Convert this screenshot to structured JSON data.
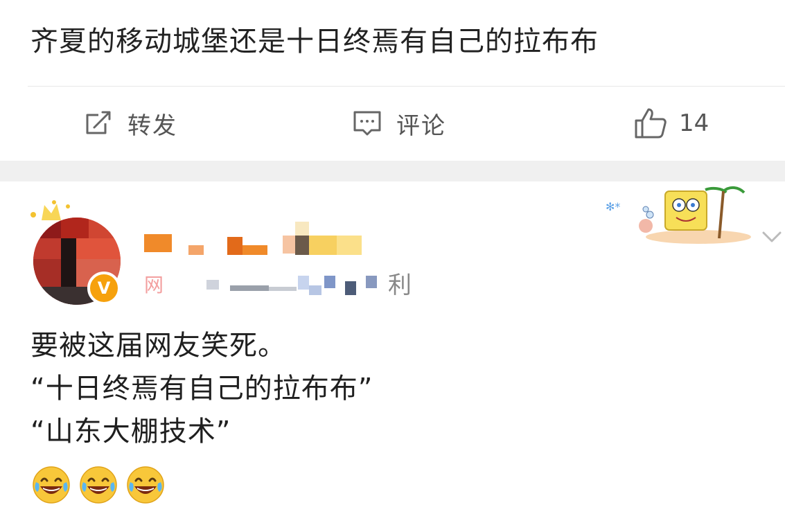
{
  "post": {
    "text": "齐夏的移动城堡还是十日终焉有自己的拉布布"
  },
  "actions": {
    "repost_label": "转发",
    "comment_label": "评论",
    "like_count": "14"
  },
  "reply": {
    "meta_tail": "利",
    "meta_head": "网",
    "lines": [
      "要被这届网友笑死。",
      "“十日终焉有自己的拉布布”",
      "“山东大棚技术”"
    ],
    "emojis": [
      "laugh-cry-emoji",
      "laugh-cry-emoji",
      "laugh-cry-emoji"
    ],
    "verify_badge": "V"
  },
  "colors": {
    "accent_orange": "#f6a10d",
    "text_dark": "#222222",
    "text_muted": "#555555",
    "separator": "#f0f0f0"
  },
  "icons": {
    "repost": "repost-icon",
    "comment": "comment-icon",
    "like": "thumbs-up-icon",
    "more": "chevron-down-icon"
  }
}
